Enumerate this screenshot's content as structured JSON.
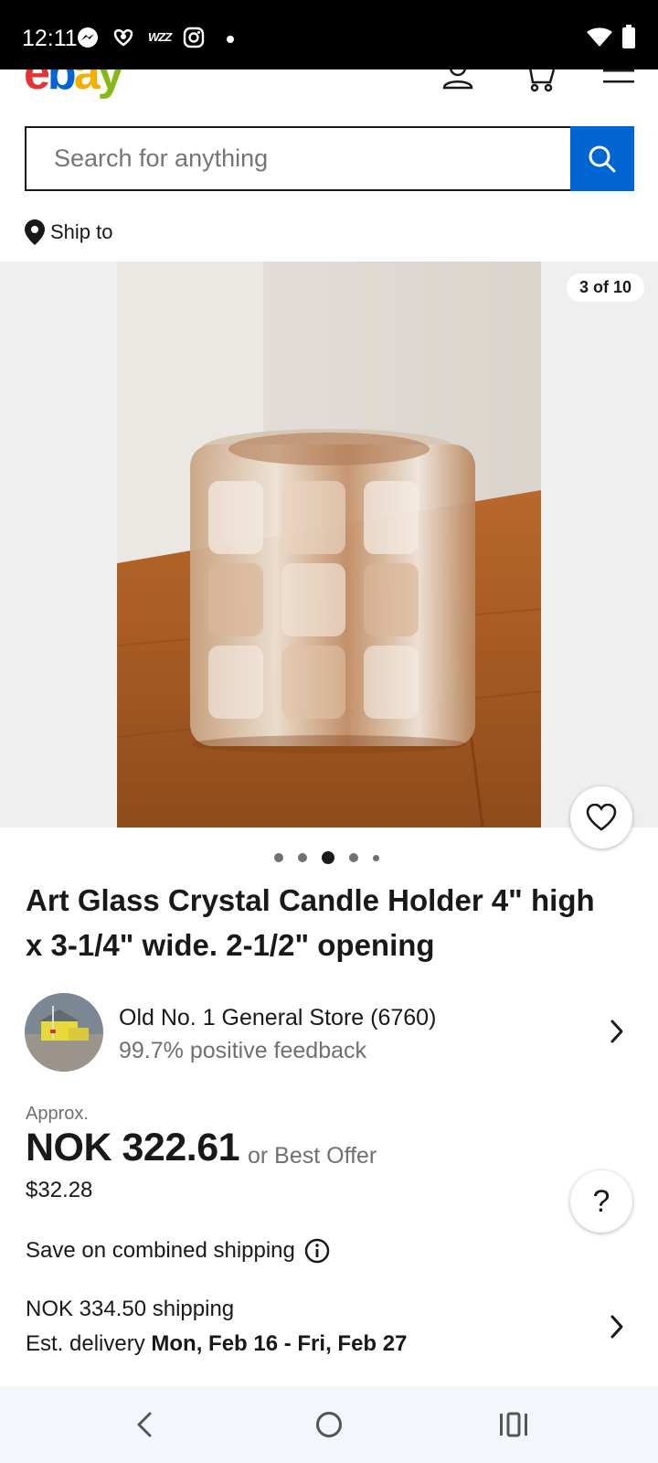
{
  "status_bar": {
    "time": "12:11",
    "icons": [
      "messenger-icon",
      "clover-icon",
      "wizz-icon",
      "instagram-icon",
      "dot-icon",
      "wifi-icon",
      "battery-icon"
    ],
    "wizz_label": "WZZ"
  },
  "header": {
    "logo": {
      "e": "e",
      "b": "b",
      "a": "a",
      "y": "y"
    },
    "icons": [
      "account-icon",
      "cart-icon",
      "menu-icon"
    ]
  },
  "search": {
    "placeholder": "Search for anything"
  },
  "ship_to": {
    "label": "Ship to"
  },
  "gallery": {
    "counter": "3 of 10",
    "dots_count": 5,
    "active_index": 2
  },
  "listing": {
    "title": "Art Glass Crystal Candle Holder 4\" high x 3-1/4\" wide. 2-1/2\" opening"
  },
  "seller": {
    "name": "Old No. 1 General Store (6760)",
    "feedback": "99.7% positive feedback"
  },
  "price": {
    "approx_label": "Approx.",
    "main": "NOK 322.61",
    "offer": "or Best Offer",
    "usd": "$32.28"
  },
  "shipping": {
    "combined": "Save on combined shipping",
    "cost": "NOK 334.50 shipping",
    "delivery_prefix": "Est. delivery ",
    "delivery_dates": "Mon, Feb 16 - Fri, Feb 27"
  },
  "help": {
    "label": "?"
  },
  "colors": {
    "accent": "#0064d2",
    "text": "#191919",
    "secondary_text": "#707070"
  }
}
